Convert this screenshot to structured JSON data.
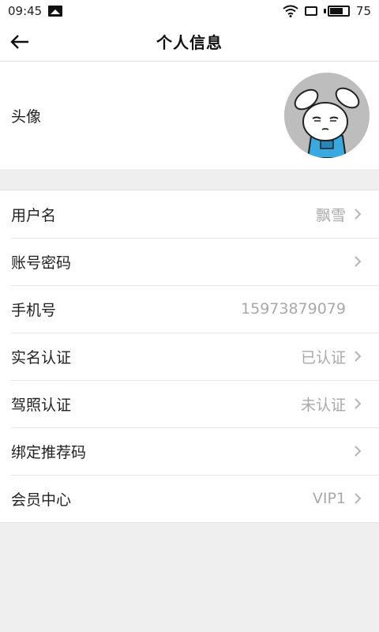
{
  "status_bar": {
    "time": "09:45",
    "battery_level": "75",
    "battery_fraction": 0.75
  },
  "header": {
    "title": "个人信息",
    "back_icon": "arrow-left-icon"
  },
  "avatar_row": {
    "label": "头像",
    "image": "cartoon-rabbit-avatar"
  },
  "items": [
    {
      "label": "用户名",
      "value": "飘雪",
      "chevron": true
    },
    {
      "label": "账号密码",
      "value": "",
      "chevron": true
    },
    {
      "label": "手机号",
      "value": "15973879079",
      "chevron": false
    },
    {
      "label": "实名认证",
      "value": "已认证",
      "chevron": true
    },
    {
      "label": "驾照认证",
      "value": "未认证",
      "chevron": true
    },
    {
      "label": "绑定推荐码",
      "value": "",
      "chevron": true
    },
    {
      "label": "会员中心",
      "value": "VIP1",
      "chevron": true
    }
  ],
  "colors": {
    "background": "#efefef",
    "surface": "#ffffff",
    "secondary_text": "#a9a9a9",
    "avatar_bg": "#bdbdbd",
    "avatar_accent": "#3aa9e0"
  }
}
